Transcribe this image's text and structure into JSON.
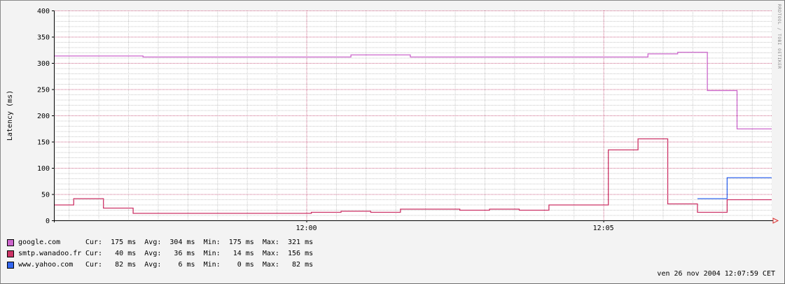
{
  "chart_data": {
    "type": "line",
    "ylabel": "Latency (ms)",
    "ylim": [
      0,
      400
    ],
    "yticks": [
      "0",
      "50",
      "100",
      "150",
      "200",
      "250",
      "300",
      "350",
      "400"
    ],
    "xlim": [
      "11:55:45",
      "12:07:50"
    ],
    "xticks": [
      {
        "time": "12:00:00",
        "label": "12:00"
      },
      {
        "time": "12:05:00",
        "label": "12:05"
      }
    ],
    "watermark": "RRDTOOL / TOBI OETIKER",
    "series": [
      {
        "name": "google.com",
        "color": "#cc66cc",
        "stats": {
          "cur": "175 ms",
          "avg": "304 ms",
          "min": "175 ms",
          "max": "321 ms"
        },
        "points": [
          [
            "11:55:45",
            314
          ],
          [
            "11:56:15",
            314
          ],
          [
            "11:56:45",
            314
          ],
          [
            "11:57:15",
            312
          ],
          [
            "11:57:45",
            312
          ],
          [
            "11:58:15",
            312
          ],
          [
            "11:58:45",
            312
          ],
          [
            "11:59:15",
            312
          ],
          [
            "11:59:45",
            312
          ],
          [
            "12:00:15",
            312
          ],
          [
            "12:00:45",
            316
          ],
          [
            "12:01:15",
            316
          ],
          [
            "12:01:45",
            312
          ],
          [
            "12:02:15",
            312
          ],
          [
            "12:02:45",
            312
          ],
          [
            "12:03:15",
            312
          ],
          [
            "12:03:45",
            312
          ],
          [
            "12:04:15",
            312
          ],
          [
            "12:04:45",
            312
          ],
          [
            "12:05:15",
            312
          ],
          [
            "12:05:45",
            318
          ],
          [
            "12:06:15",
            321
          ],
          [
            "12:06:45",
            248
          ],
          [
            "12:07:15",
            175
          ],
          [
            "12:07:50",
            175
          ]
        ]
      },
      {
        "name": "smtp.wanadoo.fr",
        "color": "#cc3366",
        "stats": {
          "cur": "40 ms",
          "avg": "36 ms",
          "min": "14 ms",
          "max": "156 ms"
        },
        "points": [
          [
            "11:55:45",
            30
          ],
          [
            "11:56:05",
            42
          ],
          [
            "11:56:35",
            24
          ],
          [
            "11:57:05",
            14
          ],
          [
            "11:57:35",
            14
          ],
          [
            "11:58:05",
            14
          ],
          [
            "11:58:35",
            14
          ],
          [
            "11:59:05",
            14
          ],
          [
            "11:59:35",
            14
          ],
          [
            "12:00:05",
            16
          ],
          [
            "12:00:35",
            18
          ],
          [
            "12:01:05",
            16
          ],
          [
            "12:01:35",
            22
          ],
          [
            "12:02:05",
            22
          ],
          [
            "12:02:35",
            20
          ],
          [
            "12:03:05",
            22
          ],
          [
            "12:03:35",
            20
          ],
          [
            "12:04:05",
            30
          ],
          [
            "12:04:35",
            30
          ],
          [
            "12:05:05",
            135
          ],
          [
            "12:05:35",
            156
          ],
          [
            "12:06:05",
            32
          ],
          [
            "12:06:35",
            16
          ],
          [
            "12:07:05",
            40
          ],
          [
            "12:07:50",
            40
          ]
        ]
      },
      {
        "name": "www.yahoo.com",
        "color": "#3366ee",
        "stats": {
          "cur": "82 ms",
          "avg": "6 ms",
          "min": "0 ms",
          "max": "82 ms"
        },
        "points": [
          [
            "12:06:35",
            42
          ],
          [
            "12:07:05",
            82
          ],
          [
            "12:07:50",
            82
          ]
        ]
      }
    ]
  },
  "legend": {
    "cur_label": "Cur:",
    "avg_label": "Avg:",
    "min_label": "Min:",
    "max_label": "Max:"
  },
  "timestamp": "ven 26 nov 2004 12:07:59 CET"
}
